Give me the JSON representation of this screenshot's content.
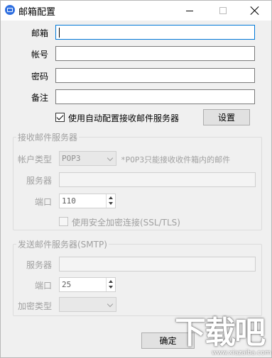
{
  "window": {
    "title": "邮箱配置"
  },
  "form": {
    "email_label": "邮箱",
    "account_label": "帐号",
    "password_label": "密码",
    "note_label": "备注",
    "auto_config_label": "使用自动配置接收邮件服务器",
    "auto_config_checked": true,
    "settings_button": "设置"
  },
  "incoming": {
    "group_title": "接收邮件服务器",
    "account_type_label": "帐户类型",
    "account_type_value": "POP3",
    "account_type_note": "*POP3只能接收收件箱内的邮件",
    "server_label": "服务器",
    "port_label": "端口",
    "port_value": "110",
    "ssl_label": "使用安全加密连接(SSL/TLS)"
  },
  "outgoing": {
    "group_title": "发送邮件服务器(SMTP)",
    "server_label": "服务器",
    "port_label": "端口",
    "port_value": "25",
    "encryption_label": "加密类型"
  },
  "footer": {
    "ok_button": "确定"
  },
  "watermark": {
    "text": "下载吧",
    "sub": "www.xiazaiba.com"
  },
  "colors": {
    "accent": "#0078d7",
    "app_icon": "#2f6fe0"
  }
}
